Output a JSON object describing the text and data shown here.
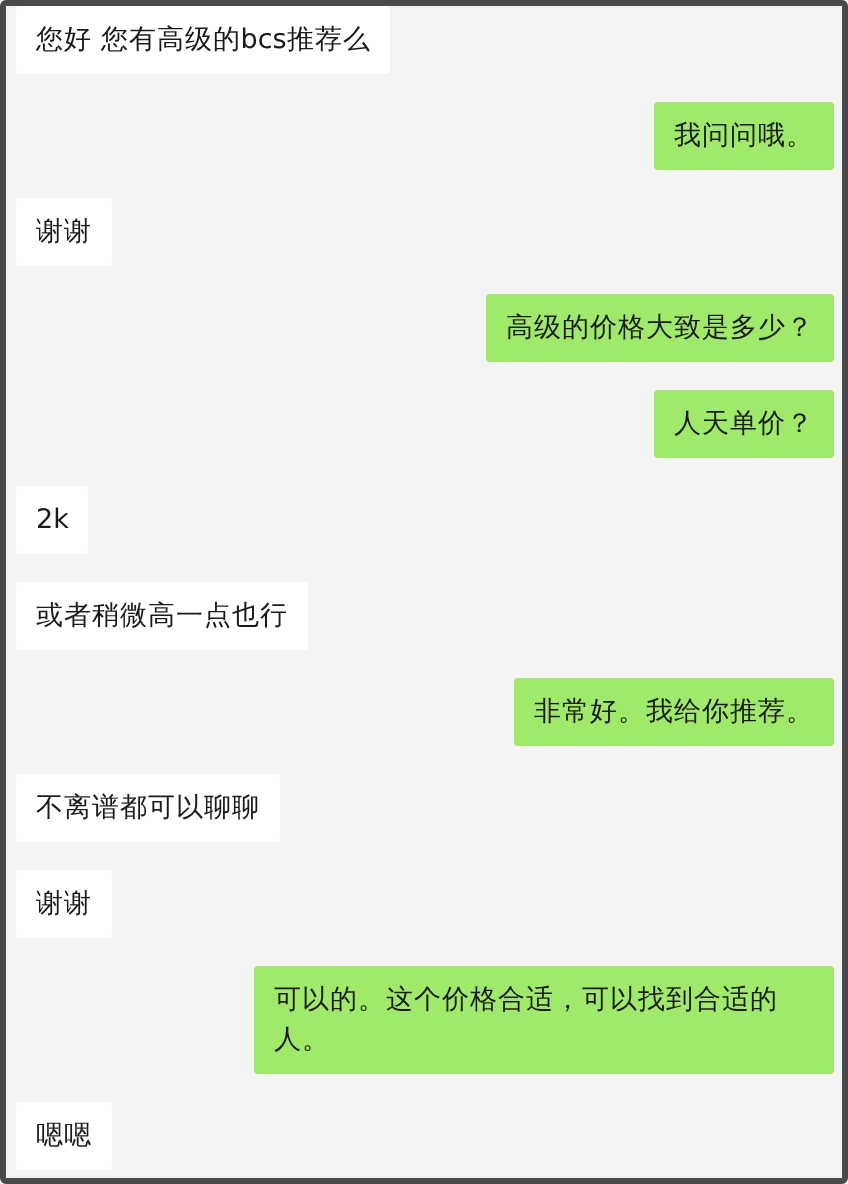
{
  "messages": [
    {
      "kind": "received",
      "text": "您好 您有高级的bcs推荐么"
    },
    {
      "kind": "sent",
      "text": "我问问哦。"
    },
    {
      "kind": "received",
      "text": "谢谢"
    },
    {
      "kind": "sent",
      "text": "高级的价格大致是多少？"
    },
    {
      "kind": "sent",
      "text": "人天单价？"
    },
    {
      "kind": "received",
      "text": "2k"
    },
    {
      "kind": "received",
      "text": "或者稍微高一点也行"
    },
    {
      "kind": "sent",
      "text": "非常好。我给你推荐。"
    },
    {
      "kind": "received",
      "text": "不离谱都可以聊聊"
    },
    {
      "kind": "received",
      "text": "谢谢"
    },
    {
      "kind": "sent",
      "text": "可以的。这个价格合适，可以找到合适的人。"
    },
    {
      "kind": "received",
      "text": "嗯嗯"
    }
  ]
}
